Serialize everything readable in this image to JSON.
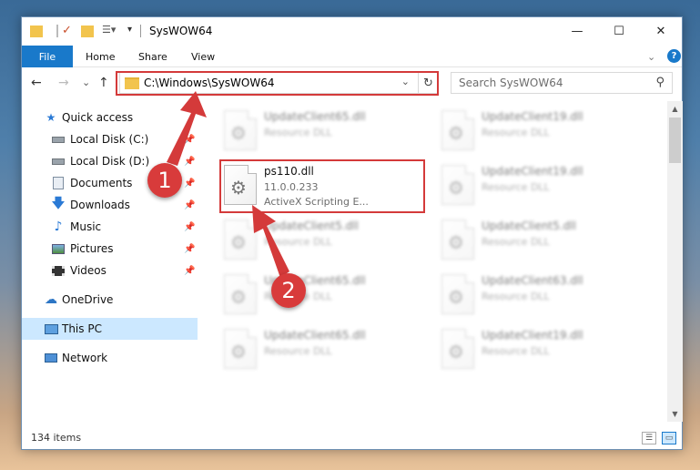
{
  "window": {
    "title": "SysWOW64",
    "controls": {
      "minimize": "—",
      "maximize": "☐",
      "close": "✕"
    }
  },
  "ribbon": {
    "tabs": [
      "File",
      "Home",
      "Share",
      "View"
    ],
    "collapse_glyph": "⌄",
    "help_glyph": "?"
  },
  "navigation": {
    "back": "←",
    "forward": "→",
    "recent": "⌄",
    "up": "↑",
    "address": "C:\\Windows\\SysWOW64",
    "address_dropdown": "⌄",
    "refresh": "↻",
    "search_placeholder": "Search SysWOW64"
  },
  "sidebar": {
    "items": [
      {
        "label": "Quick access",
        "icon": "star-icon",
        "pinned": false
      },
      {
        "label": "Local Disk (C:)",
        "icon": "drive-icon",
        "pinned": true
      },
      {
        "label": "Local Disk (D:)",
        "icon": "drive-icon",
        "pinned": true
      },
      {
        "label": "Documents",
        "icon": "documents-icon",
        "pinned": true
      },
      {
        "label": "Downloads",
        "icon": "download-icon",
        "pinned": true
      },
      {
        "label": "Music",
        "icon": "music-icon",
        "pinned": true
      },
      {
        "label": "Pictures",
        "icon": "pictures-icon",
        "pinned": true
      },
      {
        "label": "Videos",
        "icon": "videos-icon",
        "pinned": true
      },
      {
        "label": "OneDrive",
        "icon": "cloud-icon",
        "pinned": false
      },
      {
        "label": "This PC",
        "icon": "computer-icon",
        "pinned": false,
        "selected": true
      },
      {
        "label": "Network",
        "icon": "network-icon",
        "pinned": false
      }
    ]
  },
  "files": {
    "highlighted": {
      "name": "ps110.dll",
      "version": "11.0.0.233",
      "description": "ActiveX Scripting E..."
    },
    "blurred": [
      {
        "name": "UpdateClient65.dll",
        "type": "Resource DLL"
      },
      {
        "name": "UpdateClient19.dll",
        "type": "Resource DLL"
      },
      {
        "name": "UpdateClient19.dll",
        "type": "Resource DLL"
      },
      {
        "name": "UpdateClient5.dll",
        "type": "Resource DLL"
      },
      {
        "name": "UpdateClient5.dll",
        "type": "Resource DLL"
      },
      {
        "name": "UpdateClient65.dll",
        "type": "Resource DLL"
      },
      {
        "name": "UpdateClient63.dll",
        "type": "Resource DLL"
      },
      {
        "name": "UpdateClient65.dll",
        "type": "Resource DLL"
      },
      {
        "name": "UpdateClient19.dll",
        "type": "Resource DLL"
      }
    ]
  },
  "status": {
    "item_count": "134 items"
  },
  "annotations": {
    "step1": "1",
    "step2": "2",
    "color": "#d43a3a"
  }
}
